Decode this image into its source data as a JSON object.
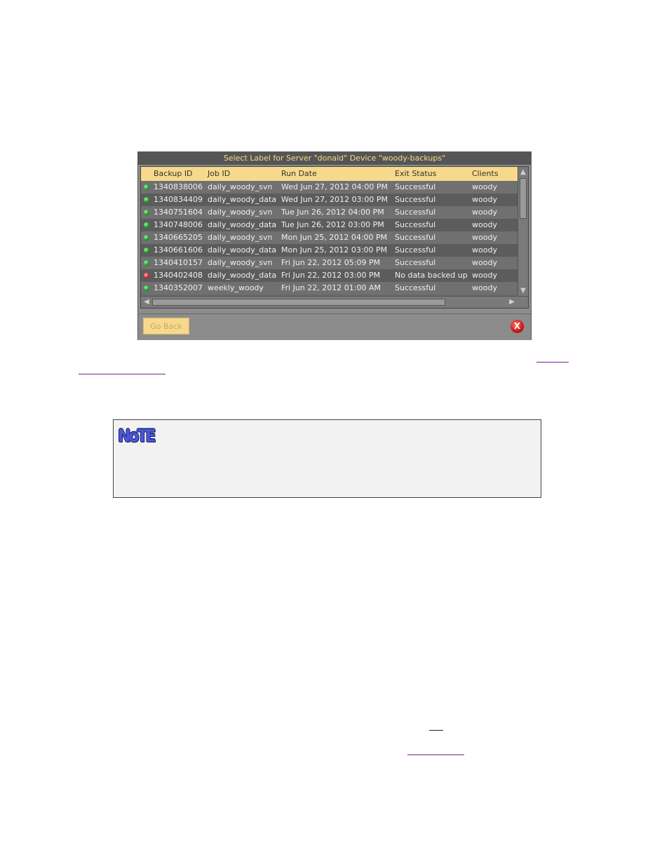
{
  "dialog": {
    "title": "Select Label for Server \"donald\" Device \"woody-backups\"",
    "columns": [
      "Backup ID",
      "Job ID",
      "Run Date",
      "Exit Status",
      "Clients"
    ],
    "rows": [
      {
        "status": "ok",
        "backup_id": "1340838006",
        "job_id": "daily_woody_svn",
        "run_date": "Wed Jun 27, 2012 04:00 PM",
        "exit_status": "Successful",
        "client": "woody"
      },
      {
        "status": "ok",
        "backup_id": "1340834409",
        "job_id": "daily_woody_data",
        "run_date": "Wed Jun 27, 2012 03:00 PM",
        "exit_status": "Successful",
        "client": "woody"
      },
      {
        "status": "ok",
        "backup_id": "1340751604",
        "job_id": "daily_woody_svn",
        "run_date": "Tue Jun 26, 2012 04:00 PM",
        "exit_status": "Successful",
        "client": "woody"
      },
      {
        "status": "ok",
        "backup_id": "1340748006",
        "job_id": "daily_woody_data",
        "run_date": "Tue Jun 26, 2012 03:00 PM",
        "exit_status": "Successful",
        "client": "woody"
      },
      {
        "status": "ok",
        "backup_id": "1340665205",
        "job_id": "daily_woody_svn",
        "run_date": "Mon Jun 25, 2012 04:00 PM",
        "exit_status": "Successful",
        "client": "woody"
      },
      {
        "status": "ok",
        "backup_id": "1340661606",
        "job_id": "daily_woody_data",
        "run_date": "Mon Jun 25, 2012 03:00 PM",
        "exit_status": "Successful",
        "client": "woody"
      },
      {
        "status": "ok",
        "backup_id": "1340410157",
        "job_id": "daily_woody_svn",
        "run_date": "Fri Jun 22, 2012 05:09 PM",
        "exit_status": "Successful",
        "client": "woody"
      },
      {
        "status": "err",
        "backup_id": "1340402408",
        "job_id": "daily_woody_data",
        "run_date": "Fri Jun 22, 2012 03:00 PM",
        "exit_status": "No data backed up",
        "client": "woody"
      },
      {
        "status": "ok",
        "backup_id": "1340352007",
        "job_id": "weekly_woody",
        "run_date": "Fri Jun 22, 2012 01:00 AM",
        "exit_status": "Successful",
        "client": "woody"
      }
    ],
    "go_back_label": "Go Back",
    "close_glyph": "X"
  },
  "note": {
    "icon_text": "NoTE"
  },
  "colors": {
    "header_bg": "#f7d98b",
    "title_text": "#f5d98a",
    "ok_status": "#1f9a2e",
    "error_status": "#d82020"
  }
}
